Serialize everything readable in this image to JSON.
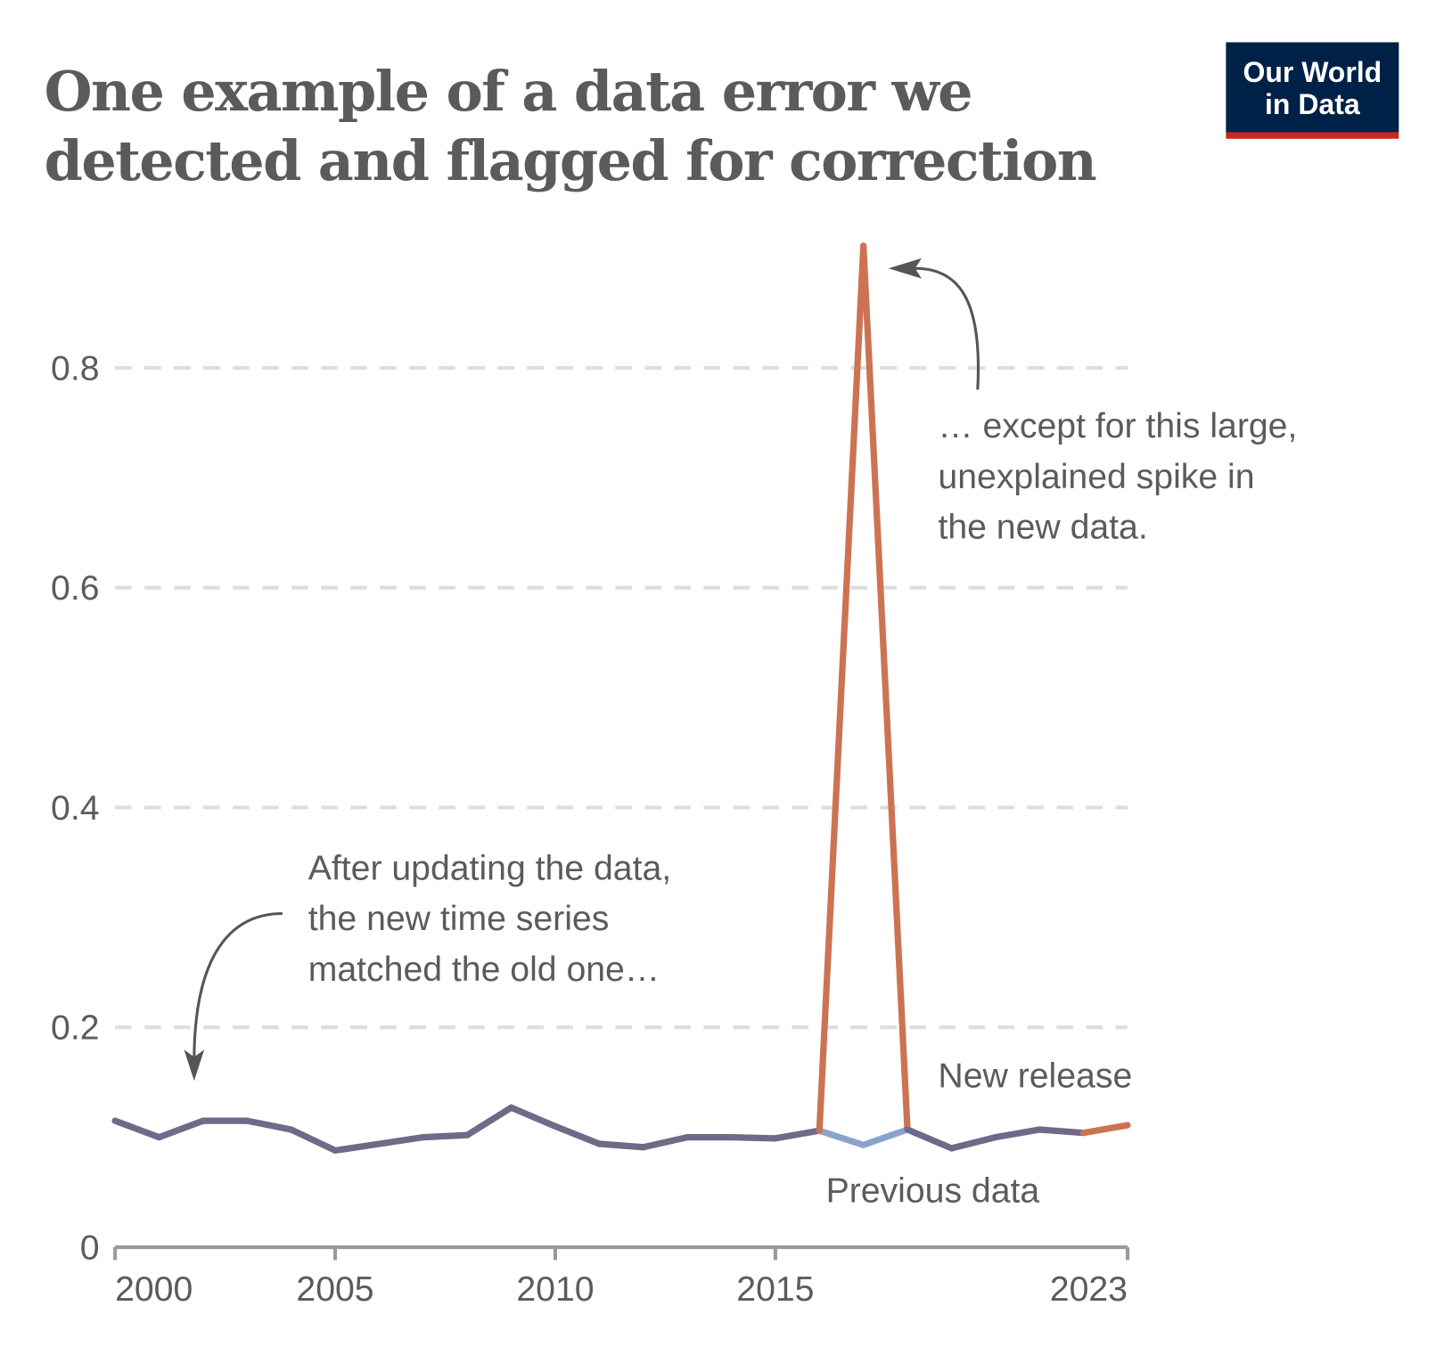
{
  "title": [
    "One example of a data error we",
    "detected and flagged for correction"
  ],
  "logo": {
    "lines": [
      "Our World",
      "in Data"
    ],
    "bg_color": "#002147",
    "accent_color": "#ce261e"
  },
  "chart_data": {
    "type": "line",
    "title": "One example of a data error we detected and flagged for correction",
    "xlim": [
      2000,
      2023
    ],
    "ylim": [
      0,
      0.9
    ],
    "x_ticks": [
      "2000",
      "2005",
      "2010",
      "2015",
      "2023"
    ],
    "y_ticks": [
      "0",
      "0.2",
      "0.4",
      "0.6",
      "0.8"
    ],
    "grid": "horizontal dashed",
    "series": [
      {
        "name": "New release",
        "color": "#cc7353",
        "label_color": "#c15a35",
        "x": [
          2000,
          2001,
          2002,
          2003,
          2004,
          2005,
          2006,
          2007,
          2008,
          2009,
          2010,
          2011,
          2012,
          2013,
          2014,
          2015,
          2016,
          2017,
          2018,
          2019,
          2020,
          2021,
          2022,
          2023
        ],
        "y": [
          0.115,
          0.1,
          0.115,
          0.115,
          0.107,
          0.088,
          0.094,
          0.1,
          0.102,
          0.127,
          0.11,
          0.094,
          0.091,
          0.1,
          0.1,
          0.099,
          0.106,
          0.911,
          0.107,
          0.09,
          0.1,
          0.107,
          0.104,
          0.111
        ]
      },
      {
        "name": "Previous data",
        "color": "#8aa3cc",
        "label_color": "#6e8bb8",
        "x": [
          2000,
          2001,
          2002,
          2003,
          2004,
          2005,
          2006,
          2007,
          2008,
          2009,
          2010,
          2011,
          2012,
          2013,
          2014,
          2015,
          2016,
          2017,
          2018,
          2019,
          2020,
          2021,
          2022
        ],
        "y": [
          0.115,
          0.1,
          0.115,
          0.115,
          0.107,
          0.088,
          0.094,
          0.1,
          0.102,
          0.127,
          0.11,
          0.094,
          0.091,
          0.1,
          0.1,
          0.099,
          0.106,
          0.093,
          0.107,
          0.09,
          0.1,
          0.107,
          0.104
        ]
      }
    ],
    "overlap_color": "#6e6a87",
    "annotations": [
      {
        "lines": [
          "After updating the data,",
          "the new time series",
          "matched the old one…"
        ]
      },
      {
        "lines": [
          "… except for this large,",
          "unexplained spike in",
          "the new data."
        ]
      }
    ]
  }
}
